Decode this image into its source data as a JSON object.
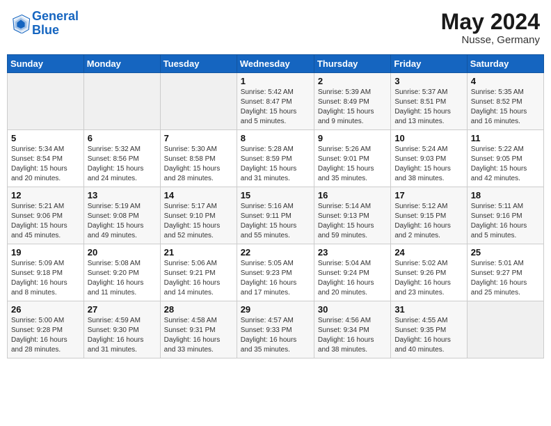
{
  "header": {
    "logo_line1": "General",
    "logo_line2": "Blue",
    "month_year": "May 2024",
    "location": "Nusse, Germany"
  },
  "weekdays": [
    "Sunday",
    "Monday",
    "Tuesday",
    "Wednesday",
    "Thursday",
    "Friday",
    "Saturday"
  ],
  "weeks": [
    [
      {
        "day": "",
        "info": ""
      },
      {
        "day": "",
        "info": ""
      },
      {
        "day": "",
        "info": ""
      },
      {
        "day": "1",
        "info": "Sunrise: 5:42 AM\nSunset: 8:47 PM\nDaylight: 15 hours\nand 5 minutes."
      },
      {
        "day": "2",
        "info": "Sunrise: 5:39 AM\nSunset: 8:49 PM\nDaylight: 15 hours\nand 9 minutes."
      },
      {
        "day": "3",
        "info": "Sunrise: 5:37 AM\nSunset: 8:51 PM\nDaylight: 15 hours\nand 13 minutes."
      },
      {
        "day": "4",
        "info": "Sunrise: 5:35 AM\nSunset: 8:52 PM\nDaylight: 15 hours\nand 16 minutes."
      }
    ],
    [
      {
        "day": "5",
        "info": "Sunrise: 5:34 AM\nSunset: 8:54 PM\nDaylight: 15 hours\nand 20 minutes."
      },
      {
        "day": "6",
        "info": "Sunrise: 5:32 AM\nSunset: 8:56 PM\nDaylight: 15 hours\nand 24 minutes."
      },
      {
        "day": "7",
        "info": "Sunrise: 5:30 AM\nSunset: 8:58 PM\nDaylight: 15 hours\nand 28 minutes."
      },
      {
        "day": "8",
        "info": "Sunrise: 5:28 AM\nSunset: 8:59 PM\nDaylight: 15 hours\nand 31 minutes."
      },
      {
        "day": "9",
        "info": "Sunrise: 5:26 AM\nSunset: 9:01 PM\nDaylight: 15 hours\nand 35 minutes."
      },
      {
        "day": "10",
        "info": "Sunrise: 5:24 AM\nSunset: 9:03 PM\nDaylight: 15 hours\nand 38 minutes."
      },
      {
        "day": "11",
        "info": "Sunrise: 5:22 AM\nSunset: 9:05 PM\nDaylight: 15 hours\nand 42 minutes."
      }
    ],
    [
      {
        "day": "12",
        "info": "Sunrise: 5:21 AM\nSunset: 9:06 PM\nDaylight: 15 hours\nand 45 minutes."
      },
      {
        "day": "13",
        "info": "Sunrise: 5:19 AM\nSunset: 9:08 PM\nDaylight: 15 hours\nand 49 minutes."
      },
      {
        "day": "14",
        "info": "Sunrise: 5:17 AM\nSunset: 9:10 PM\nDaylight: 15 hours\nand 52 minutes."
      },
      {
        "day": "15",
        "info": "Sunrise: 5:16 AM\nSunset: 9:11 PM\nDaylight: 15 hours\nand 55 minutes."
      },
      {
        "day": "16",
        "info": "Sunrise: 5:14 AM\nSunset: 9:13 PM\nDaylight: 15 hours\nand 59 minutes."
      },
      {
        "day": "17",
        "info": "Sunrise: 5:12 AM\nSunset: 9:15 PM\nDaylight: 16 hours\nand 2 minutes."
      },
      {
        "day": "18",
        "info": "Sunrise: 5:11 AM\nSunset: 9:16 PM\nDaylight: 16 hours\nand 5 minutes."
      }
    ],
    [
      {
        "day": "19",
        "info": "Sunrise: 5:09 AM\nSunset: 9:18 PM\nDaylight: 16 hours\nand 8 minutes."
      },
      {
        "day": "20",
        "info": "Sunrise: 5:08 AM\nSunset: 9:20 PM\nDaylight: 16 hours\nand 11 minutes."
      },
      {
        "day": "21",
        "info": "Sunrise: 5:06 AM\nSunset: 9:21 PM\nDaylight: 16 hours\nand 14 minutes."
      },
      {
        "day": "22",
        "info": "Sunrise: 5:05 AM\nSunset: 9:23 PM\nDaylight: 16 hours\nand 17 minutes."
      },
      {
        "day": "23",
        "info": "Sunrise: 5:04 AM\nSunset: 9:24 PM\nDaylight: 16 hours\nand 20 minutes."
      },
      {
        "day": "24",
        "info": "Sunrise: 5:02 AM\nSunset: 9:26 PM\nDaylight: 16 hours\nand 23 minutes."
      },
      {
        "day": "25",
        "info": "Sunrise: 5:01 AM\nSunset: 9:27 PM\nDaylight: 16 hours\nand 25 minutes."
      }
    ],
    [
      {
        "day": "26",
        "info": "Sunrise: 5:00 AM\nSunset: 9:28 PM\nDaylight: 16 hours\nand 28 minutes."
      },
      {
        "day": "27",
        "info": "Sunrise: 4:59 AM\nSunset: 9:30 PM\nDaylight: 16 hours\nand 31 minutes."
      },
      {
        "day": "28",
        "info": "Sunrise: 4:58 AM\nSunset: 9:31 PM\nDaylight: 16 hours\nand 33 minutes."
      },
      {
        "day": "29",
        "info": "Sunrise: 4:57 AM\nSunset: 9:33 PM\nDaylight: 16 hours\nand 35 minutes."
      },
      {
        "day": "30",
        "info": "Sunrise: 4:56 AM\nSunset: 9:34 PM\nDaylight: 16 hours\nand 38 minutes."
      },
      {
        "day": "31",
        "info": "Sunrise: 4:55 AM\nSunset: 9:35 PM\nDaylight: 16 hours\nand 40 minutes."
      },
      {
        "day": "",
        "info": ""
      }
    ]
  ]
}
